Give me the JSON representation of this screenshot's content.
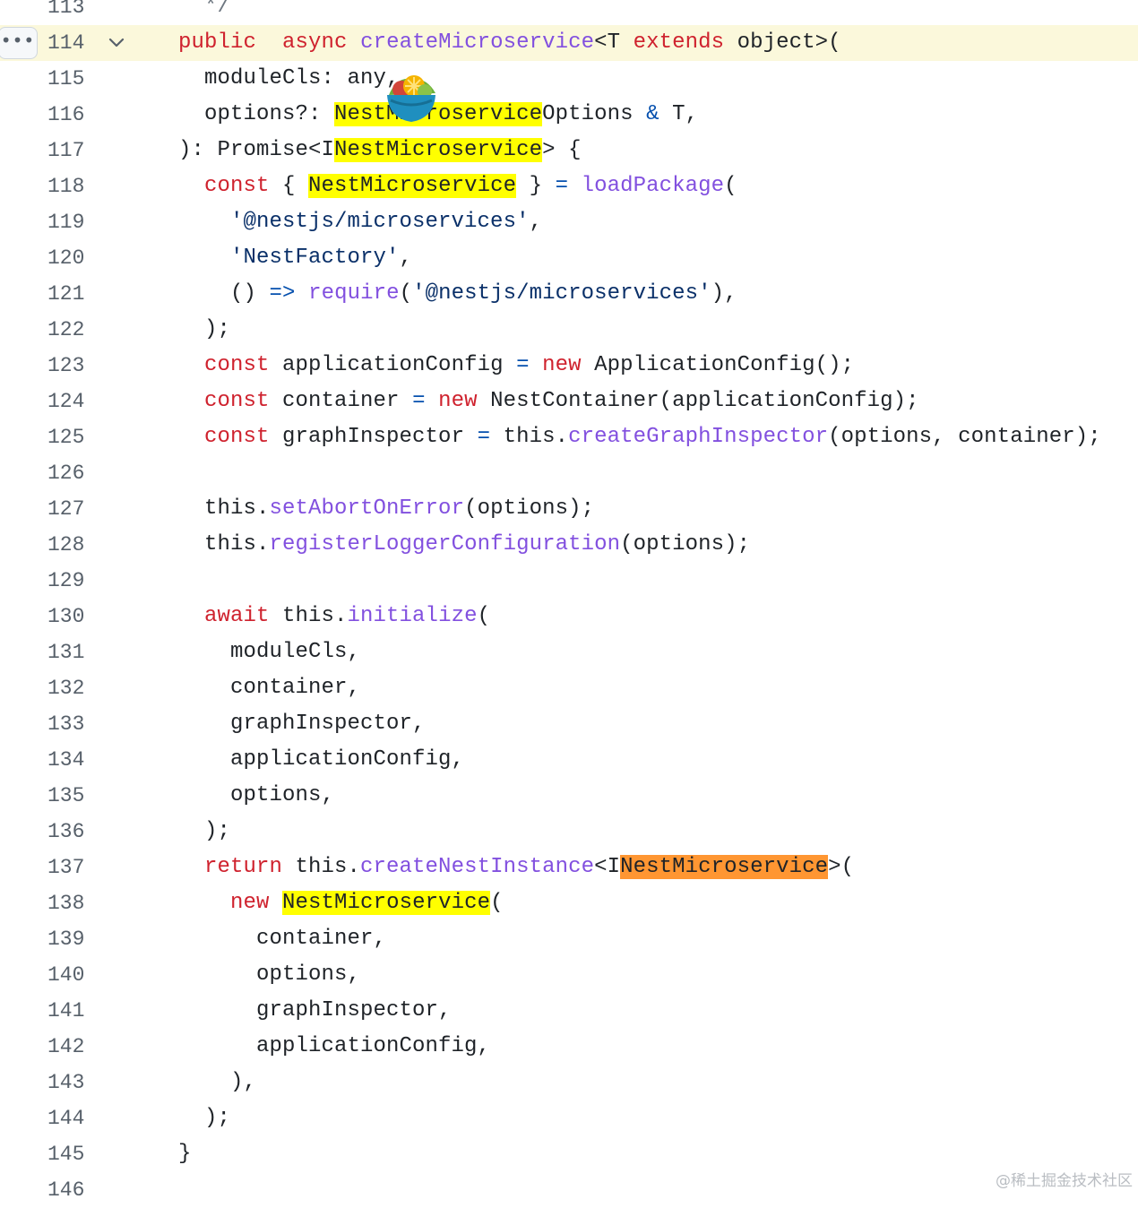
{
  "colors": {
    "keyword": "#cf222e",
    "function": "#8250df",
    "string": "#0a3069",
    "operator": "#0550ae",
    "line_highlight": "#fbf8db",
    "search_match": "#ffff00",
    "current_match": "#ff9632"
  },
  "gutter": {
    "more_button_label": "•••",
    "fold_icon": "chevron-down-icon"
  },
  "code": {
    "highlighted_line": 114,
    "lines": [
      {
        "n": "113",
        "tokens": [
          [
            "cm",
            "  */"
          ]
        ]
      },
      {
        "n": "114",
        "tokens": [
          [
            "kw",
            "public"
          ],
          [
            "",
            "  "
          ],
          [
            "kw",
            "async"
          ],
          [
            "",
            " "
          ],
          [
            "fn",
            "createMicroservice"
          ],
          [
            "",
            "<T "
          ],
          [
            "kw",
            "extends"
          ],
          [
            "",
            " object>("
          ]
        ]
      },
      {
        "n": "115",
        "tokens": [
          [
            "",
            "  moduleCls: any,"
          ]
        ]
      },
      {
        "n": "116",
        "tokens": [
          [
            "",
            "  options?: "
          ],
          [
            "hly",
            "NestMicroservice"
          ],
          [
            "",
            "Options "
          ],
          [
            "op",
            "&"
          ],
          [
            "",
            " T,"
          ]
        ]
      },
      {
        "n": "117",
        "tokens": [
          [
            "",
            "): Promise<I"
          ],
          [
            "hly",
            "NestMicroservice"
          ],
          [
            "",
            "> {"
          ]
        ]
      },
      {
        "n": "118",
        "tokens": [
          [
            "",
            "  "
          ],
          [
            "kw",
            "const"
          ],
          [
            "",
            " { "
          ],
          [
            "hly",
            "NestMicroservice"
          ],
          [
            "",
            " } "
          ],
          [
            "op",
            "="
          ],
          [
            "",
            " "
          ],
          [
            "fn",
            "loadPackage"
          ],
          [
            "",
            "("
          ]
        ]
      },
      {
        "n": "119",
        "tokens": [
          [
            "",
            "    "
          ],
          [
            "str",
            "'@nestjs/microservices'"
          ],
          [
            "",
            ","
          ]
        ]
      },
      {
        "n": "120",
        "tokens": [
          [
            "",
            "    "
          ],
          [
            "str",
            "'NestFactory'"
          ],
          [
            "",
            ","
          ]
        ]
      },
      {
        "n": "121",
        "tokens": [
          [
            "",
            "    () "
          ],
          [
            "op",
            "=>"
          ],
          [
            "",
            " "
          ],
          [
            "fn",
            "require"
          ],
          [
            "",
            "("
          ],
          [
            "str",
            "'@nestjs/microservices'"
          ],
          [
            "",
            "),"
          ]
        ]
      },
      {
        "n": "122",
        "tokens": [
          [
            "",
            "  );"
          ]
        ]
      },
      {
        "n": "123",
        "tokens": [
          [
            "",
            "  "
          ],
          [
            "kw",
            "const"
          ],
          [
            "",
            " applicationConfig "
          ],
          [
            "op",
            "="
          ],
          [
            "",
            " "
          ],
          [
            "kw",
            "new"
          ],
          [
            "",
            " ApplicationConfig();"
          ]
        ]
      },
      {
        "n": "124",
        "tokens": [
          [
            "",
            "  "
          ],
          [
            "kw",
            "const"
          ],
          [
            "",
            " container "
          ],
          [
            "op",
            "="
          ],
          [
            "",
            " "
          ],
          [
            "kw",
            "new"
          ],
          [
            "",
            " NestContainer(applicationConfig);"
          ]
        ]
      },
      {
        "n": "125",
        "tokens": [
          [
            "",
            "  "
          ],
          [
            "kw",
            "const"
          ],
          [
            "",
            " graphInspector "
          ],
          [
            "op",
            "="
          ],
          [
            "",
            " this."
          ],
          [
            "fn",
            "createGraphInspector"
          ],
          [
            "",
            "(options, container);"
          ]
        ]
      },
      {
        "n": "126",
        "tokens": []
      },
      {
        "n": "127",
        "tokens": [
          [
            "",
            "  this."
          ],
          [
            "fn",
            "setAbortOnError"
          ],
          [
            "",
            "(options);"
          ]
        ]
      },
      {
        "n": "128",
        "tokens": [
          [
            "",
            "  this."
          ],
          [
            "fn",
            "registerLoggerConfiguration"
          ],
          [
            "",
            "(options);"
          ]
        ]
      },
      {
        "n": "129",
        "tokens": []
      },
      {
        "n": "130",
        "tokens": [
          [
            "",
            "  "
          ],
          [
            "kw",
            "await"
          ],
          [
            "",
            " this."
          ],
          [
            "fn",
            "initialize"
          ],
          [
            "",
            "("
          ]
        ]
      },
      {
        "n": "131",
        "tokens": [
          [
            "",
            "    moduleCls,"
          ]
        ]
      },
      {
        "n": "132",
        "tokens": [
          [
            "",
            "    container,"
          ]
        ]
      },
      {
        "n": "133",
        "tokens": [
          [
            "",
            "    graphInspector,"
          ]
        ]
      },
      {
        "n": "134",
        "tokens": [
          [
            "",
            "    applicationConfig,"
          ]
        ]
      },
      {
        "n": "135",
        "tokens": [
          [
            "",
            "    options,"
          ]
        ]
      },
      {
        "n": "136",
        "tokens": [
          [
            "",
            "  );"
          ]
        ]
      },
      {
        "n": "137",
        "tokens": [
          [
            "",
            "  "
          ],
          [
            "kw",
            "return"
          ],
          [
            "",
            " this."
          ],
          [
            "fn",
            "createNestInstance"
          ],
          [
            "",
            "<I"
          ],
          [
            "hlo",
            "NestMicroservice"
          ],
          [
            "",
            ">("
          ]
        ]
      },
      {
        "n": "138",
        "tokens": [
          [
            "",
            "    "
          ],
          [
            "kw",
            "new"
          ],
          [
            "",
            " "
          ],
          [
            "hly",
            "NestMicroservice"
          ],
          [
            "",
            "("
          ]
        ]
      },
      {
        "n": "139",
        "tokens": [
          [
            "",
            "      container,"
          ]
        ]
      },
      {
        "n": "140",
        "tokens": [
          [
            "",
            "      options,"
          ]
        ]
      },
      {
        "n": "141",
        "tokens": [
          [
            "",
            "      graphInspector,"
          ]
        ]
      },
      {
        "n": "142",
        "tokens": [
          [
            "",
            "      applicationConfig,"
          ]
        ]
      },
      {
        "n": "143",
        "tokens": [
          [
            "",
            "    ),"
          ]
        ]
      },
      {
        "n": "144",
        "tokens": [
          [
            "",
            "  );"
          ]
        ]
      },
      {
        "n": "145",
        "tokens": [
          [
            "",
            "}"
          ]
        ]
      },
      {
        "n": "146",
        "tokens": []
      }
    ]
  },
  "watermark": "@稀土掘金技术社区"
}
